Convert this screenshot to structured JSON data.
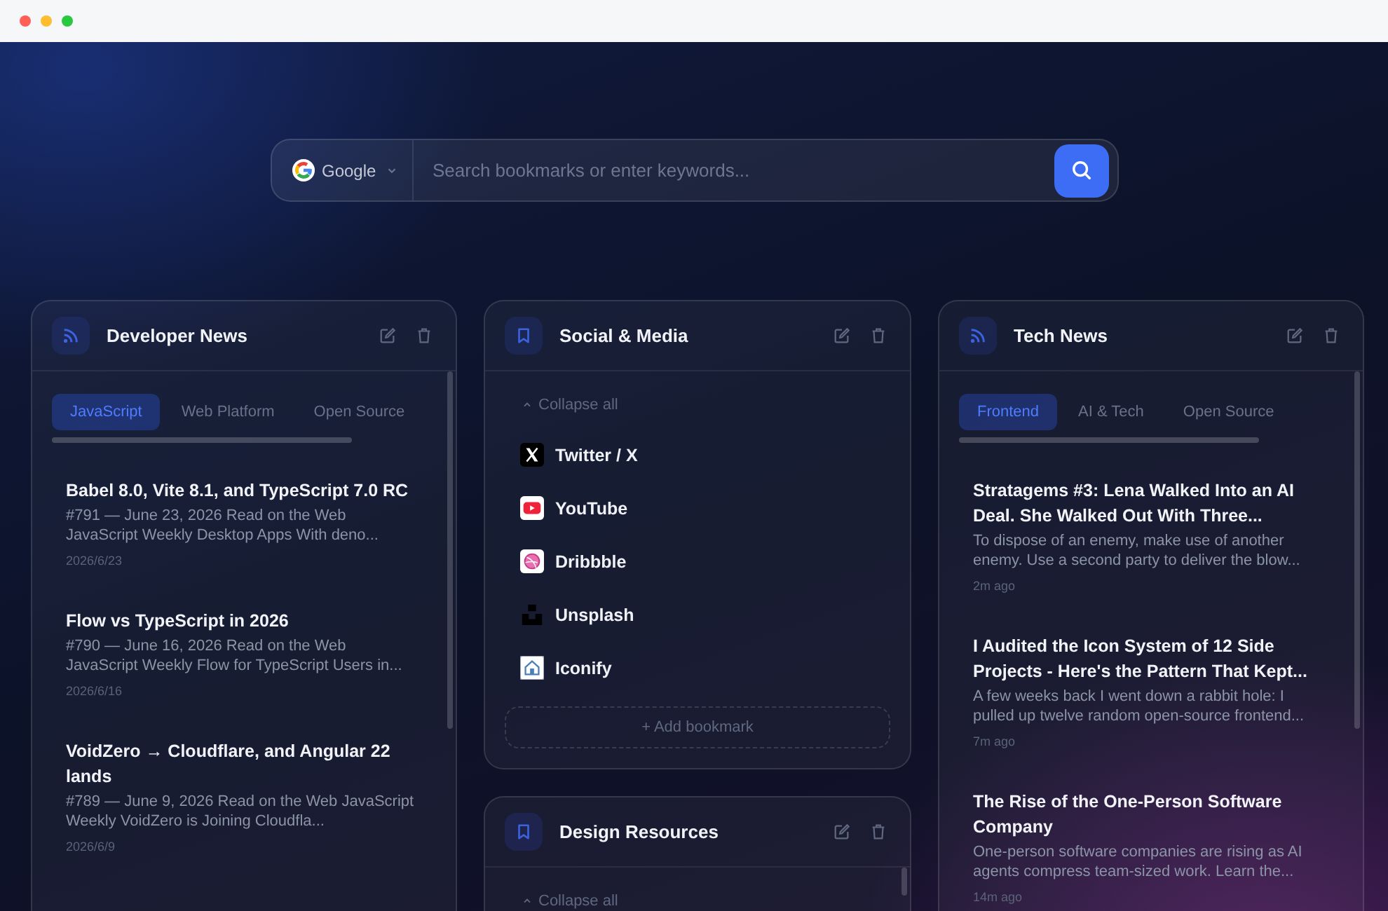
{
  "search": {
    "engine": "Google",
    "placeholder": "Search bookmarks or enter keywords..."
  },
  "columns": [
    [
      {
        "kind": "feed",
        "title": "Developer News",
        "tabs": [
          {
            "label": "JavaScript",
            "selected": true
          },
          {
            "label": "Web Platform",
            "selected": false
          },
          {
            "label": "Open Source",
            "selected": false
          }
        ],
        "items": [
          {
            "title": "Babel 8.0, Vite 8.1, and TypeScript 7.0 RC",
            "summary": "#791 — June 23, 2026 Read on the Web JavaScript Weekly Desktop Apps With deno...",
            "meta": "2026/6/23"
          },
          {
            "title": "Flow vs TypeScript in 2026",
            "summary": "#790 — June 16, 2026 Read on the Web JavaScript Weekly Flow for TypeScript Users in...",
            "meta": "2026/6/16"
          },
          {
            "title": "VoidZero → Cloudflare, and Angular 22 lands",
            "summary": "#789 — June 9, 2026 Read on the Web JavaScript Weekly VoidZero is Joining Cloudfla...",
            "meta": "2026/6/9"
          }
        ]
      }
    ],
    [
      {
        "kind": "bookmarks",
        "title": "Social & Media",
        "collapse_label": "Collapse all",
        "bookmarks": [
          {
            "name": "Twitter / X"
          },
          {
            "name": "YouTube"
          },
          {
            "name": "Dribbble"
          },
          {
            "name": "Unsplash"
          },
          {
            "name": "Iconify"
          }
        ],
        "add_label": "+ Add bookmark"
      },
      {
        "kind": "bookmarks",
        "title": "Design Resources",
        "collapse_label": "Collapse all"
      }
    ],
    [
      {
        "kind": "feed",
        "title": "Tech News",
        "tabs": [
          {
            "label": "Frontend",
            "selected": true
          },
          {
            "label": "AI & Tech",
            "selected": false
          },
          {
            "label": "Open Source",
            "selected": false
          }
        ],
        "items": [
          {
            "title": "Stratagems #3: Lena Walked Into an AI Deal. She Walked Out With Three...",
            "summary": "To dispose of an enemy, make use of another enemy. Use a second party to deliver the blow...",
            "meta": "2m ago"
          },
          {
            "title": "I Audited the Icon System of 12 Side Projects - Here's the Pattern That Kept...",
            "summary": "A few weeks back I went down a rabbit hole: I pulled up twelve random open-source frontend...",
            "meta": "7m ago"
          },
          {
            "title": "The Rise of the One-Person Software Company",
            "summary": "One-person software companies are rising as AI agents compress team-sized work. Learn the...",
            "meta": "14m ago"
          }
        ]
      }
    ]
  ]
}
